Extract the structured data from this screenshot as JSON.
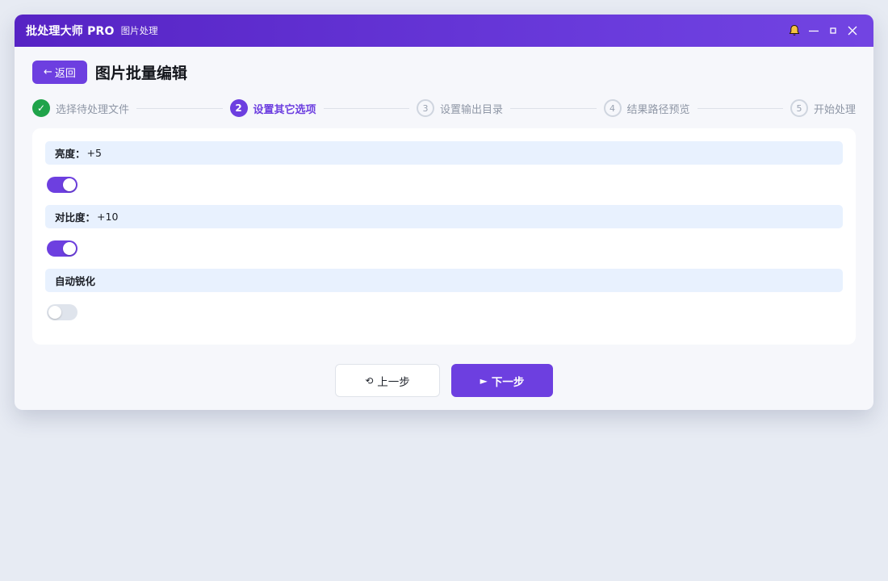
{
  "window": {
    "app_name": "批处理大师 PRO",
    "app_subtitle": "图片处理"
  },
  "header": {
    "back_arrow": "←",
    "back_label": "返回",
    "page_title": "图片批量编辑"
  },
  "stepper": {
    "steps": [
      {
        "marker": "✓",
        "label": "选择待处理文件",
        "status": "done"
      },
      {
        "marker": "2",
        "label": "设置其它选项",
        "status": "active"
      },
      {
        "marker": "3",
        "label": "设置输出目录",
        "status": "pending"
      },
      {
        "marker": "4",
        "label": "结果路径预览",
        "status": "pending"
      },
      {
        "marker": "5",
        "label": "开始处理",
        "status": "pending"
      }
    ]
  },
  "options": [
    {
      "label": "亮度：",
      "value": "+5",
      "enabled": true
    },
    {
      "label": "对比度：",
      "value": "+10",
      "enabled": true
    },
    {
      "label": "自动锐化",
      "value": "",
      "enabled": false
    }
  ],
  "footer": {
    "prev_icon": "⟲",
    "prev_label": "上一步",
    "next_icon": "►",
    "next_label": "下一步"
  },
  "colors": {
    "accent": "#6d3fe0",
    "titlebar": "#5623c4",
    "success": "#1fa34a",
    "option_header_bg": "#e8f1fe",
    "toggle_off": "#dfe4ec"
  },
  "icons": {
    "bell": "bell-icon",
    "minimize": "minimize-icon",
    "maximize": "maximize-icon",
    "close": "close-icon"
  }
}
